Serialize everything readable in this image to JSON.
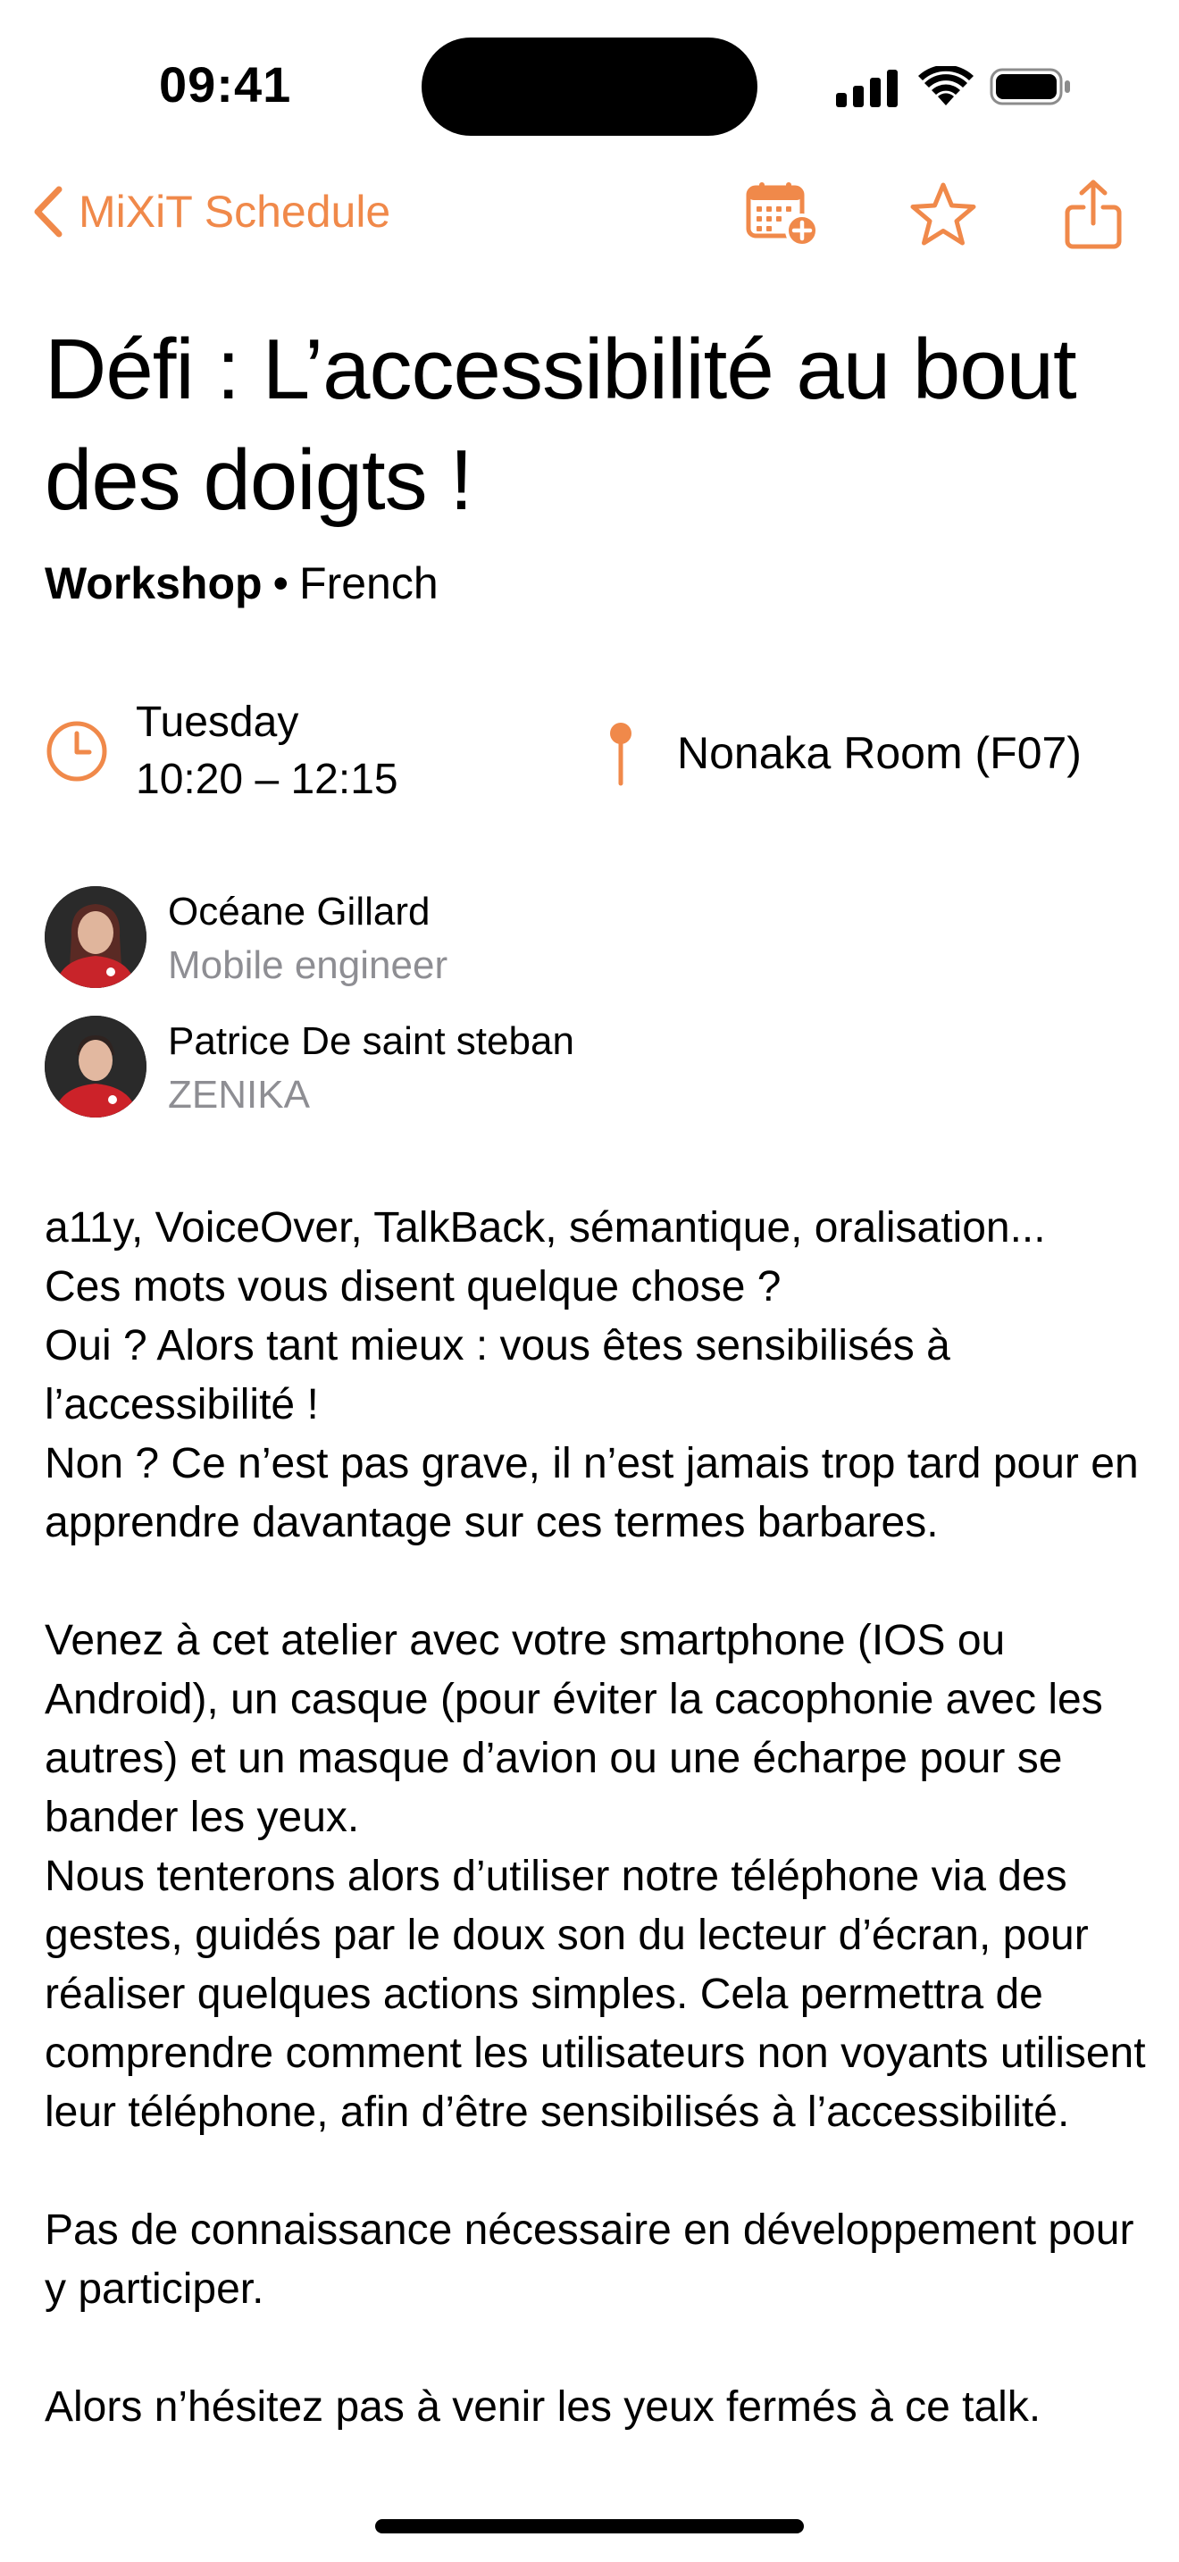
{
  "status_bar": {
    "time": "09:41"
  },
  "nav": {
    "back_label": "MiXiT Schedule",
    "accent_color": "#f0894a",
    "icons": [
      "calendar-add-icon",
      "star-icon",
      "share-icon"
    ]
  },
  "session": {
    "title": "Défi : L’accessibilité au bout des doigts !",
    "type": "Workshop",
    "separator": "•",
    "language": "French",
    "day": "Tuesday",
    "time_range": "10:20 – 12:15",
    "room": "Nonaka Room (F07)"
  },
  "speakers": [
    {
      "name": "Océane Gillard",
      "role": "Mobile engineer"
    },
    {
      "name": "Patrice De saint steban",
      "role": "ZENIKA"
    }
  ],
  "description": "a11y, VoiceOver, TalkBack, sémantique, oralisation...\nCes mots vous disent quelque chose ?\nOui ? Alors tant mieux : vous êtes sensibilisés à l’accessibilité !\nNon ? Ce n’est pas grave, il n’est jamais trop tard pour en apprendre davantage sur ces termes barbares.\n\nVenez à cet atelier avec votre smartphone (IOS ou Android), un casque (pour éviter la cacophonie avec les autres) et un masque d’avion ou une écharpe pour se bander les yeux.\nNous tenterons alors d’utiliser notre téléphone via des gestes, guidés par le doux son du lecteur d’écran, pour réaliser quelques actions simples. Cela permettra de comprendre comment les utilisateurs non voyants utilisent leur téléphone, afin d’être sensibilisés à l’accessibilité.\n\nPas de connaissance nécessaire en développement pour y participer.\n\nAlors n’hésitez pas à venir les yeux fermés à ce talk."
}
